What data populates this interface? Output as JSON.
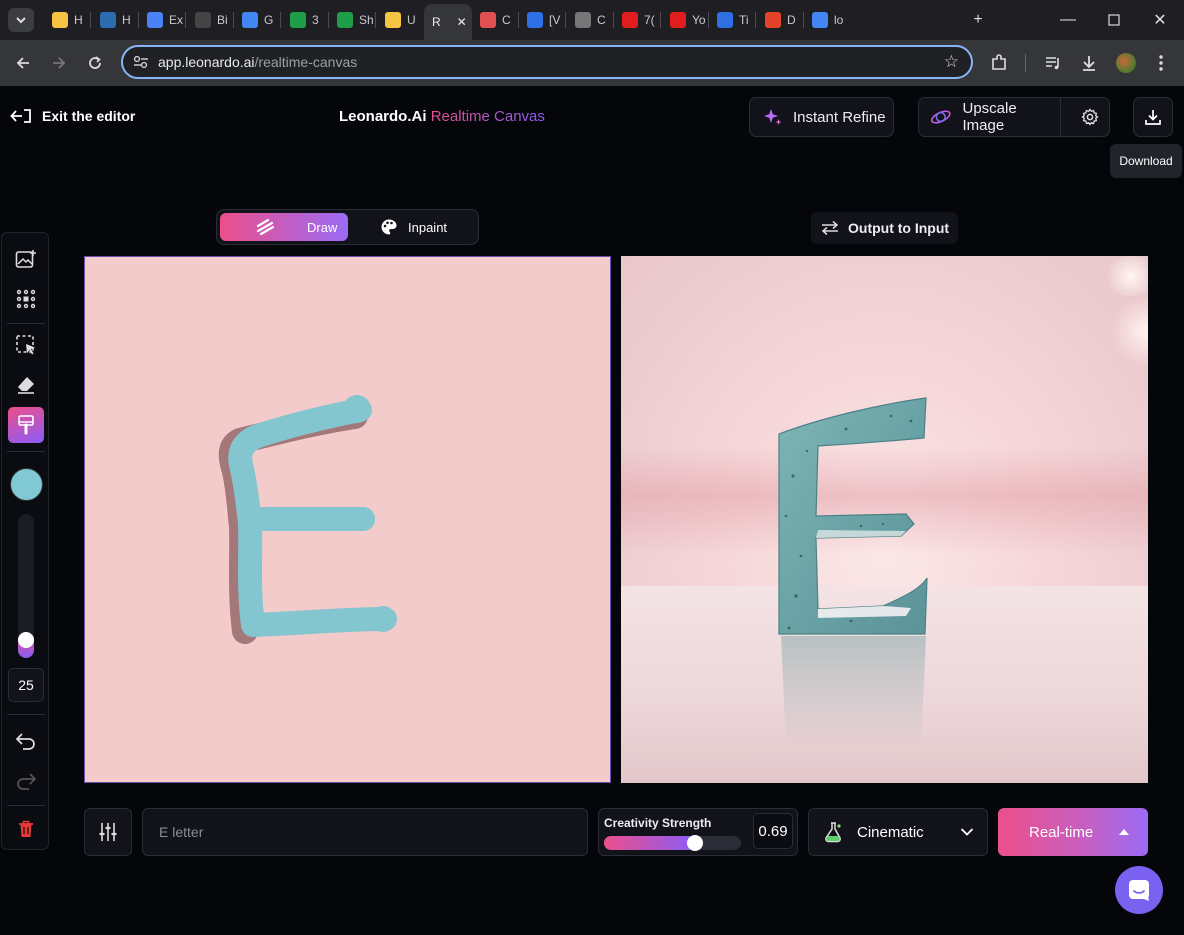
{
  "browser": {
    "tabs": [
      {
        "label": "H",
        "color": "#f6c343"
      },
      {
        "label": "H",
        "color": "#2b6cb0"
      },
      {
        "label": "Ex",
        "color": "#4a82f7"
      },
      {
        "label": "Bi",
        "color": "#444"
      },
      {
        "label": "G",
        "color": "#4285f4"
      },
      {
        "label": "3",
        "color": "#1e9e4a"
      },
      {
        "label": "Sh",
        "color": "#1e9e4a"
      },
      {
        "label": "U",
        "color": "#f5c542"
      },
      {
        "label": "R",
        "color": "#222"
      },
      {
        "label": "C",
        "color": "#e05252"
      },
      {
        "label": "[V",
        "color": "#2f6fe4"
      },
      {
        "label": "C",
        "color": "#777"
      },
      {
        "label": "7(",
        "color": "#e11d1d"
      },
      {
        "label": "Yo",
        "color": "#e11d1d"
      },
      {
        "label": "Ti",
        "color": "#2f6fe4"
      },
      {
        "label": "D",
        "color": "#e24329"
      },
      {
        "label": "lo",
        "color": "#4285f4"
      }
    ],
    "url_host": "app.leonardo.ai",
    "url_path": "/realtime-canvas"
  },
  "header": {
    "exit_label": "Exit the editor",
    "brand": "Leonardo.Ai",
    "brand_sub": "Realtime Canvas",
    "instant_refine": "Instant Refine",
    "upscale": "Upscale Image",
    "download_tooltip": "Download"
  },
  "mode_toggle": {
    "draw": "Draw",
    "inpaint": "Inpaint"
  },
  "output_to_input": "Output to Input",
  "toolbar": {
    "brush_size": "25",
    "brush_color": "#80c8d4",
    "brush_slider_value": 0.07
  },
  "bottom": {
    "prompt_value": "E letter",
    "creativity_label": "Creativity Strength",
    "creativity_value": "0.69",
    "creativity_fraction": 0.69,
    "style": "Cinematic",
    "realtime_label": "Real-time"
  },
  "colors": {
    "accent_pink": "#ec4f8a",
    "accent_purple": "#8b5cf6",
    "canvas_bg": "#f4cbcb"
  }
}
